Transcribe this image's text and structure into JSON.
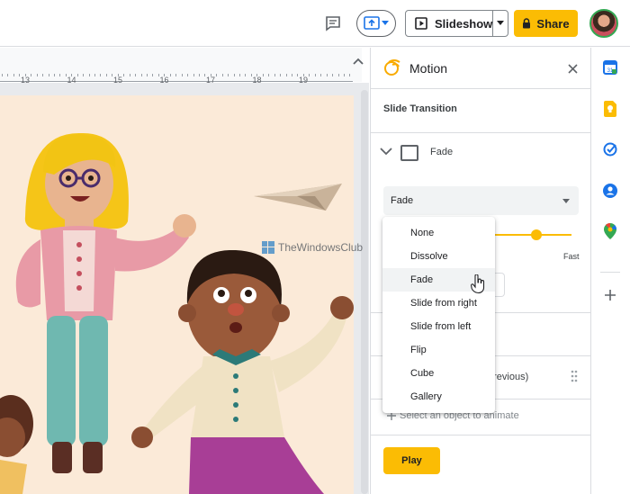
{
  "toolbar": {
    "slideshow_label": "Slideshow",
    "share_label": "Share"
  },
  "ruler": {
    "labels": [
      "13",
      "14",
      "15",
      "16",
      "17",
      "18",
      "19"
    ]
  },
  "watermark": {
    "text": "TheWindowsClub"
  },
  "panel": {
    "title": "Motion",
    "section_title": "Slide Transition",
    "transition_name": "Fade",
    "select_value": "Fade",
    "fast_label": "Fast",
    "previous_text": "previous)",
    "add_object_text": "Select an object to animate",
    "play_label": "Play"
  },
  "menu": {
    "items": [
      "None",
      "Dissolve",
      "Fade",
      "Slide from right",
      "Slide from left",
      "Flip",
      "Cube",
      "Gallery"
    ],
    "hovered": "Fade"
  },
  "colors": {
    "accent": "#fbbc04",
    "slide_bg": "#fbead8"
  },
  "icons": {
    "side": [
      "calendar-icon",
      "keep-icon",
      "tasks-icon",
      "contacts-icon",
      "maps-icon",
      "add-icon"
    ]
  }
}
